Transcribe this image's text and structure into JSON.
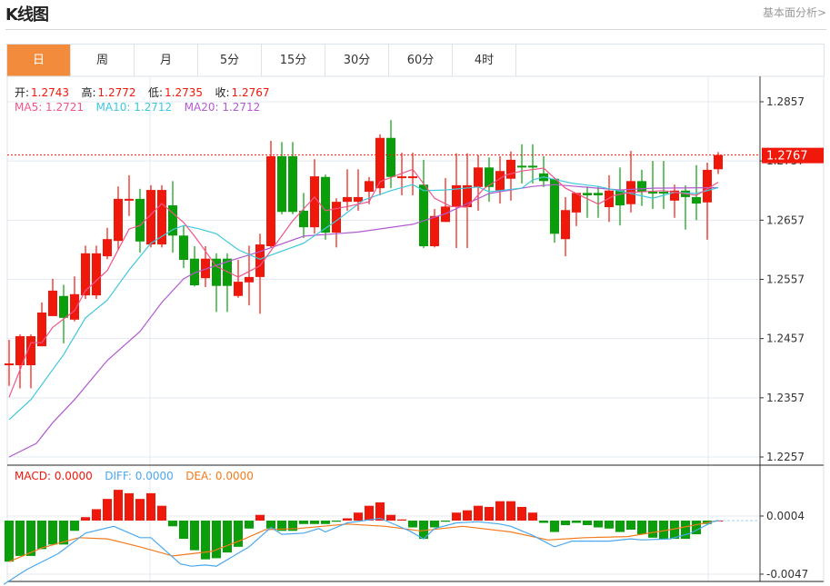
{
  "header": {
    "title": "K线图",
    "link": "基本面分析>"
  },
  "tabs": [
    {
      "label": "日",
      "active": true
    },
    {
      "label": "周"
    },
    {
      "label": "月"
    },
    {
      "label": "5分"
    },
    {
      "label": "15分"
    },
    {
      "label": "30分"
    },
    {
      "label": "60分"
    },
    {
      "label": "4时"
    }
  ],
  "ohlc_legend": {
    "open_label": "开:",
    "open": "1.2743",
    "high_label": "高:",
    "high": "1.2772",
    "low_label": "低:",
    "low": "1.2735",
    "close_label": "收:",
    "close": "1.2767"
  },
  "ma_legend": {
    "ma5": "MA5: 1.2721",
    "ma10": "MA10: 1.2712",
    "ma20": "MA20: 1.2712"
  },
  "macd_legend": {
    "macd": "MACD: 0.0000",
    "diff": "DIFF: 0.0000",
    "dea": "DEA: 0.0000"
  },
  "colors": {
    "up": "#f0170b",
    "down": "#0a9e0a",
    "accent": "#f28c3c",
    "ma5": "#f0558a",
    "ma10": "#3ec8dc",
    "ma20": "#b25ad0",
    "diff": "#4aa8ee",
    "dea": "#f27a1e"
  },
  "chart_data": [
    {
      "type": "candlestick",
      "price_axis": {
        "ticks": [
          "1.2857",
          "1.2757",
          "1.2657",
          "1.2557",
          "1.2457",
          "1.2357",
          "1.2257"
        ],
        "range": [
          1.2257,
          1.2857
        ]
      },
      "current_price": "1.2767",
      "grid": true,
      "candles": [
        [
          1.2415,
          1.2455,
          1.2377,
          1.2415
        ],
        [
          1.2412,
          1.2464,
          1.2373,
          1.2461
        ],
        [
          1.2412,
          1.2464,
          1.2373,
          1.2461
        ],
        [
          1.2444,
          1.2518,
          1.2444,
          1.2501
        ],
        [
          1.2495,
          1.2558,
          1.2495,
          1.2538
        ],
        [
          1.2529,
          1.2548,
          1.2449,
          1.2492
        ],
        [
          1.2489,
          1.2562,
          1.2486,
          1.2532
        ],
        [
          1.253,
          1.2614,
          1.2524,
          1.2601
        ],
        [
          1.253,
          1.2614,
          1.2524,
          1.2601
        ],
        [
          1.2596,
          1.2644,
          1.2591,
          1.2625
        ],
        [
          1.2622,
          1.2714,
          1.2607,
          1.2693
        ],
        [
          1.2692,
          1.2733,
          1.2664,
          1.2693
        ],
        [
          1.2693,
          1.271,
          1.2602,
          1.2621
        ],
        [
          1.2616,
          1.2716,
          1.2611,
          1.2708
        ],
        [
          1.2616,
          1.2716,
          1.2611,
          1.2708
        ],
        [
          1.2682,
          1.2723,
          1.2602,
          1.2631
        ],
        [
          1.2631,
          1.2648,
          1.2576,
          1.259
        ],
        [
          1.2592,
          1.2613,
          1.2545,
          1.2547
        ],
        [
          1.2559,
          1.2613,
          1.2544,
          1.2592
        ],
        [
          1.2592,
          1.2601,
          1.2502,
          1.2546
        ],
        [
          1.2592,
          1.2601,
          1.2502,
          1.2546
        ],
        [
          1.2529,
          1.259,
          1.2526,
          1.2553
        ],
        [
          1.2552,
          1.2614,
          1.2513,
          1.2561
        ],
        [
          1.2561,
          1.2634,
          1.2499,
          1.2616
        ],
        [
          1.2613,
          1.2791,
          1.261,
          1.2765
        ],
        [
          1.2765,
          1.2789,
          1.2667,
          1.2671
        ],
        [
          1.2765,
          1.2789,
          1.2667,
          1.2671
        ],
        [
          1.2673,
          1.2703,
          1.2627,
          1.2645
        ],
        [
          1.2645,
          1.276,
          1.2634,
          1.2731
        ],
        [
          1.273,
          1.2734,
          1.2624,
          1.2636
        ],
        [
          1.2636,
          1.2694,
          1.2611,
          1.2688
        ],
        [
          1.2688,
          1.2743,
          1.2673,
          1.2696
        ],
        [
          1.2688,
          1.2743,
          1.2673,
          1.2696
        ],
        [
          1.2705,
          1.273,
          1.2684,
          1.2723
        ],
        [
          1.2711,
          1.2802,
          1.2699,
          1.2796
        ],
        [
          1.2796,
          1.2826,
          1.2711,
          1.273
        ],
        [
          1.2729,
          1.2771,
          1.2699,
          1.2731
        ],
        [
          1.2729,
          1.2771,
          1.2699,
          1.2731
        ],
        [
          1.2717,
          1.2759,
          1.261,
          1.2613
        ],
        [
          1.2613,
          1.2676,
          1.2611,
          1.2664
        ],
        [
          1.2654,
          1.2728,
          1.2654,
          1.268
        ],
        [
          1.2679,
          1.277,
          1.261,
          1.2716
        ],
        [
          1.2679,
          1.277,
          1.261,
          1.2716
        ],
        [
          1.2713,
          1.2767,
          1.2673,
          1.2746
        ],
        [
          1.2746,
          1.2763,
          1.2688,
          1.2713
        ],
        [
          1.2707,
          1.2765,
          1.2685,
          1.274
        ],
        [
          1.2727,
          1.2773,
          1.269,
          1.2759
        ],
        [
          1.2749,
          1.2785,
          1.2719,
          1.2747
        ],
        [
          1.2749,
          1.2785,
          1.2719,
          1.2747
        ],
        [
          1.2736,
          1.2765,
          1.2713,
          1.2723
        ],
        [
          1.2727,
          1.2728,
          1.2619,
          1.2634
        ],
        [
          1.2625,
          1.2696,
          1.2596,
          1.2674
        ],
        [
          1.267,
          1.2703,
          1.2647,
          1.2703
        ],
        [
          1.2703,
          1.2714,
          1.2661,
          1.2699
        ],
        [
          1.2703,
          1.2714,
          1.2661,
          1.2699
        ],
        [
          1.2679,
          1.2733,
          1.2654,
          1.2707
        ],
        [
          1.2707,
          1.2746,
          1.2648,
          1.2682
        ],
        [
          1.2684,
          1.2774,
          1.267,
          1.2723
        ],
        [
          1.2723,
          1.2742,
          1.2681,
          1.2705
        ],
        [
          1.2705,
          1.2757,
          1.2676,
          1.2702
        ],
        [
          1.2705,
          1.2757,
          1.2676,
          1.2702
        ],
        [
          1.269,
          1.2717,
          1.2661,
          1.2707
        ],
        [
          1.2707,
          1.2716,
          1.2641,
          1.2696
        ],
        [
          1.2696,
          1.275,
          1.2657,
          1.2685
        ],
        [
          1.2687,
          1.2754,
          1.2624,
          1.2742
        ],
        [
          1.2743,
          1.2772,
          1.2735,
          1.2767
        ]
      ],
      "ma5": [
        [
          0,
          1.2358
        ],
        [
          2,
          1.245
        ],
        [
          3,
          1.245
        ],
        [
          4,
          1.2476
        ],
        [
          6,
          1.2504
        ],
        [
          7,
          1.2538
        ],
        [
          9,
          1.2572
        ],
        [
          11,
          1.2642
        ],
        [
          12,
          1.2648
        ],
        [
          14,
          1.2685
        ],
        [
          16,
          1.2653
        ],
        [
          17,
          1.263
        ],
        [
          19,
          1.2579
        ],
        [
          21,
          1.2561
        ],
        [
          23,
          1.258
        ],
        [
          26,
          1.2656
        ],
        [
          28,
          1.2696
        ],
        [
          29,
          1.2673
        ],
        [
          31,
          1.268
        ],
        [
          33,
          1.2688
        ],
        [
          34,
          1.2722
        ],
        [
          37,
          1.2743
        ],
        [
          39,
          1.2694
        ],
        [
          40.5,
          1.268
        ],
        [
          42,
          1.2679
        ],
        [
          43.5,
          1.271
        ],
        [
          45.5,
          1.2733
        ],
        [
          47,
          1.274
        ],
        [
          49,
          1.2745
        ],
        [
          51,
          1.2711
        ],
        [
          54,
          1.2684
        ],
        [
          55.5,
          1.2699
        ],
        [
          57,
          1.2704
        ],
        [
          60,
          1.2707
        ],
        [
          63,
          1.2699
        ],
        [
          65,
          1.2721
        ]
      ],
      "ma10": [
        [
          0,
          1.232
        ],
        [
          2,
          1.2354
        ],
        [
          5,
          1.243
        ],
        [
          7,
          1.2492
        ],
        [
          9,
          1.2522
        ],
        [
          11,
          1.2573
        ],
        [
          13,
          1.2618
        ],
        [
          15,
          1.2641
        ],
        [
          16,
          1.2648
        ],
        [
          17.5,
          1.2642
        ],
        [
          19,
          1.2634
        ],
        [
          21,
          1.2607
        ],
        [
          23,
          1.2591
        ],
        [
          24,
          1.2598
        ],
        [
          27,
          1.2618
        ],
        [
          30,
          1.2656
        ],
        [
          32.5,
          1.2691
        ],
        [
          35,
          1.2707
        ],
        [
          37,
          1.2717
        ],
        [
          38,
          1.2707
        ],
        [
          40,
          1.2708
        ],
        [
          43,
          1.2713
        ],
        [
          44,
          1.2705
        ],
        [
          47,
          1.2711
        ],
        [
          48,
          1.2725
        ],
        [
          49,
          1.273
        ],
        [
          51.7,
          1.2719
        ],
        [
          54,
          1.2714
        ],
        [
          57,
          1.2702
        ],
        [
          59,
          1.2694
        ],
        [
          61,
          1.2704
        ],
        [
          63,
          1.2702
        ],
        [
          65,
          1.2712
        ]
      ],
      "ma20": [
        [
          0,
          1.2257
        ],
        [
          2.5,
          1.228
        ],
        [
          4,
          1.2315
        ],
        [
          6,
          1.2354
        ],
        [
          9,
          1.242
        ],
        [
          12,
          1.2469
        ],
        [
          14,
          1.2518
        ],
        [
          16,
          1.2558
        ],
        [
          17,
          1.2568
        ],
        [
          20,
          1.2587
        ],
        [
          23,
          1.2604
        ],
        [
          27,
          1.263
        ],
        [
          32,
          1.2637
        ],
        [
          37,
          1.265
        ],
        [
          40,
          1.2668
        ],
        [
          44,
          1.2702
        ],
        [
          48,
          1.2714
        ],
        [
          50,
          1.2717
        ],
        [
          56,
          1.2708
        ],
        [
          59,
          1.2711
        ],
        [
          65,
          1.2712
        ]
      ]
    },
    {
      "type": "bar",
      "name": "MACD",
      "axis": {
        "ticks": [
          "0.0004",
          "-0.0047"
        ]
      },
      "histogram": [
        -0.0036,
        -0.0031,
        -0.0031,
        -0.0025,
        -0.0021,
        -0.0021,
        -0.0009,
        0.0003,
        0.001,
        0.0019,
        0.0027,
        0.0024,
        0.0019,
        0.0024,
        0.0013,
        -0.0005,
        -0.0016,
        -0.0026,
        -0.0034,
        -0.0033,
        -0.0028,
        -0.0023,
        -0.0007,
        0.0005,
        -0.0007,
        -0.0009,
        -0.0009,
        -0.0003,
        -0.0003,
        -0.0003,
        -0.0001,
        0.0002,
        0.0007,
        0.0013,
        0.0016,
        0.0005,
        0.0001,
        -0.0006,
        -0.0016,
        -0.0006,
        -0.0001,
        0.0007,
        0.0009,
        0.0013,
        0.0012,
        0.0017,
        0.0017,
        0.0012,
        0.0007,
        -0.0002,
        -0.001,
        -0.0004,
        -0.0002,
        -0.0004,
        -0.0006,
        -0.0007,
        -0.001,
        -0.0008,
        -0.0012,
        -0.0015,
        -0.0016,
        -0.0016,
        -0.0016,
        -0.0012,
        -0.0003,
        0.0
      ],
      "diff": [
        [
          -0.5,
          -0.0056
        ],
        [
          1.6,
          -0.0043
        ],
        [
          4.5,
          -0.0029
        ],
        [
          7,
          -0.0011
        ],
        [
          9.6,
          -0.0005
        ],
        [
          12,
          -0.0015
        ],
        [
          13,
          -0.0015
        ],
        [
          15.7,
          -0.0038
        ],
        [
          16.7,
          -0.004
        ],
        [
          18,
          -0.0039
        ],
        [
          19,
          -0.004
        ],
        [
          22,
          -0.0023
        ],
        [
          24,
          -0.0006
        ],
        [
          25,
          -0.0012
        ],
        [
          27,
          -0.0011
        ],
        [
          28.4,
          -0.0007
        ],
        [
          29,
          -0.001
        ],
        [
          31,
          -0.0002
        ],
        [
          34,
          0.0002
        ],
        [
          35,
          -0.0002
        ],
        [
          36.7,
          -0.0009
        ],
        [
          38,
          -0.0016
        ],
        [
          39,
          -0.0007
        ],
        [
          41,
          -0.0002
        ],
        [
          43,
          -0.0001
        ],
        [
          45,
          -0.0003
        ],
        [
          46,
          -0.0005
        ],
        [
          48,
          -0.0013
        ],
        [
          50,
          -0.0023
        ],
        [
          51.6,
          -0.0018
        ],
        [
          55,
          -0.0018
        ],
        [
          57,
          -0.0016
        ],
        [
          58,
          -0.0017
        ],
        [
          60.6,
          -0.0016
        ],
        [
          62.5,
          -0.0011
        ],
        [
          64.5,
          -0.0001
        ],
        [
          65,
          0.0
        ]
      ],
      "dea": [
        [
          0,
          -0.0036
        ],
        [
          3,
          -0.0024
        ],
        [
          6.4,
          -0.0015
        ],
        [
          9,
          -0.0016
        ],
        [
          12,
          -0.0023
        ],
        [
          15,
          -0.0031
        ],
        [
          18.6,
          -0.0027
        ],
        [
          21.6,
          -0.0016
        ],
        [
          23.5,
          -0.0008
        ],
        [
          26.4,
          -0.0007
        ],
        [
          31,
          -0.0003
        ],
        [
          34.5,
          -0.0005
        ],
        [
          37.7,
          -0.0009
        ],
        [
          41.6,
          -0.0005
        ],
        [
          46,
          -0.001
        ],
        [
          49.4,
          -0.0017
        ],
        [
          52.8,
          -0.0015
        ],
        [
          56.7,
          -0.0014
        ],
        [
          60.6,
          -0.0008
        ],
        [
          65,
          0.0
        ]
      ]
    }
  ]
}
